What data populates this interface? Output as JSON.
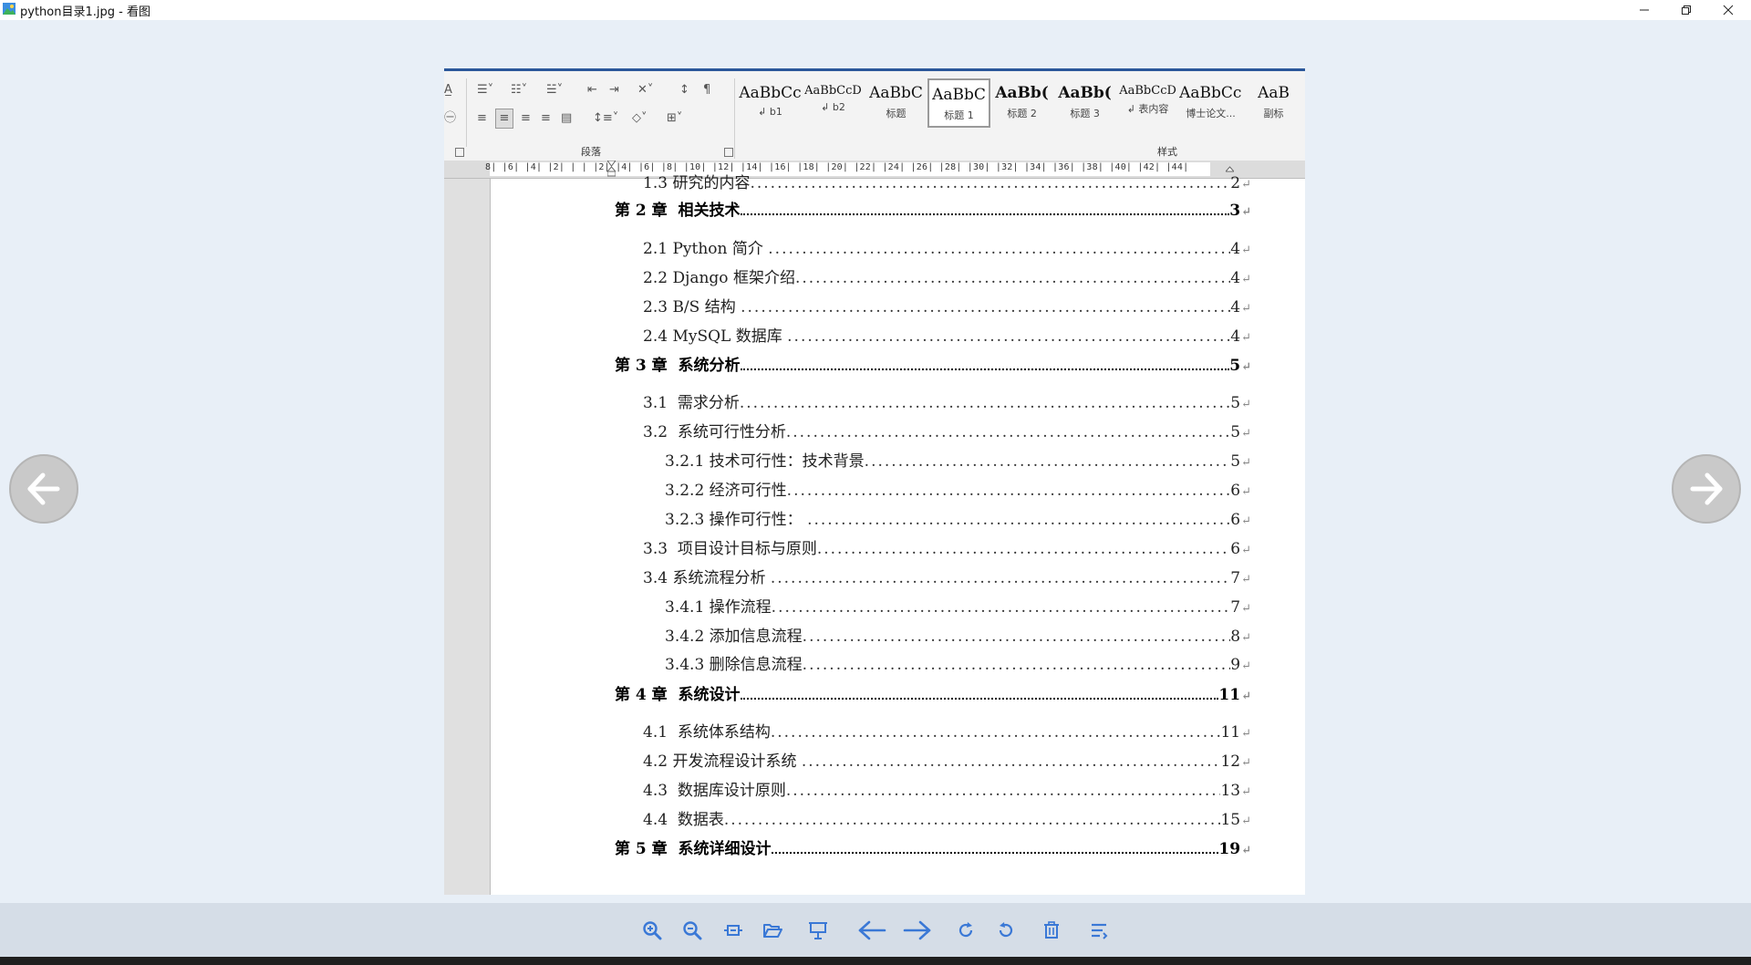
{
  "window": {
    "title": "python目录1.jpg - 看图",
    "minimize_label": "minimize",
    "restore_label": "restore",
    "close_label": "close"
  },
  "ribbon": {
    "paragraph_group_label": "段落",
    "styles_group_label": "样式",
    "styles": [
      {
        "sample": "AaBbCc",
        "name": "↲ b1"
      },
      {
        "sample": "AaBbCcD",
        "name": "↲ b2"
      },
      {
        "sample": "AaBbC",
        "name": "标题"
      },
      {
        "sample": "AaBbC",
        "name": "标题 1",
        "selected": true
      },
      {
        "sample": "AaBb(",
        "name": "标题 2"
      },
      {
        "sample": "AaBb(",
        "name": "标题 3"
      },
      {
        "sample": "AaBbCcD",
        "name": "↲ 表内容"
      },
      {
        "sample": "AaBbCcI",
        "name": "博士论文..."
      },
      {
        "sample": "AaB",
        "name": "副标"
      }
    ]
  },
  "ruler": {
    "ticks": "8| |6| |4| |2| | | |2| |4| |6| |8| |10| |12| |14| |16| |18| |20| |22| |24| |26| |28| |30| |32| |34| |36| |38| |40| |42| |44|"
  },
  "toc": [
    {
      "label": "1.3 研究的内容",
      "page": "2",
      "level": 2,
      "partial": true
    },
    {
      "label": "第 2 章  相关技术",
      "page": "3",
      "level": 1
    },
    {
      "label": "2.1 Python 简介 ",
      "page": "4",
      "level": 2
    },
    {
      "label": "2.2 Django 框架介绍",
      "page": "4",
      "level": 2
    },
    {
      "label": "2.3 B/S 结构 ",
      "page": "4",
      "level": 2
    },
    {
      "label": "2.4 MySQL 数据库 ",
      "page": "4",
      "level": 2
    },
    {
      "label": "第 3 章  系统分析",
      "page": "5",
      "level": 1
    },
    {
      "label": "3.1  需求分析",
      "page": "5",
      "level": 2
    },
    {
      "label": "3.2  系统可行性分析",
      "page": "5",
      "level": 2
    },
    {
      "label": "3.2.1 技术可行性：技术背景",
      "page": "5",
      "level": 3
    },
    {
      "label": "3.2.2 经济可行性",
      "page": "6",
      "level": 3
    },
    {
      "label": "3.2.3 操作可行性： ",
      "page": "6",
      "level": 3
    },
    {
      "label": "3.3  项目设计目标与原则",
      "page": "6",
      "level": 2
    },
    {
      "label": "3.4 系统流程分析 ",
      "page": "7",
      "level": 2
    },
    {
      "label": "3.4.1 操作流程",
      "page": "7",
      "level": 3
    },
    {
      "label": "3.4.2 添加信息流程",
      "page": "8",
      "level": 3
    },
    {
      "label": "3.4.3 删除信息流程",
      "page": "9",
      "level": 3
    },
    {
      "label": "第 4 章  系统设计",
      "page": "11",
      "level": 1
    },
    {
      "label": "4.1  系统体系结构",
      "page": "11",
      "level": 2
    },
    {
      "label": "4.2 开发流程设计系统 ",
      "page": "12",
      "level": 2
    },
    {
      "label": "4.3  数据库设计原则",
      "page": "13",
      "level": 2
    },
    {
      "label": "4.4  数据表",
      "page": "15",
      "level": 2
    },
    {
      "label": "第 5 章  系统详细设计",
      "page": "19",
      "level": 1
    }
  ],
  "navigation": {
    "prev_label": "previous image",
    "next_label": "next image"
  },
  "toolbar": {
    "buttons": [
      "zoom-in",
      "zoom-out",
      "fit-window",
      "open-folder",
      "slideshow",
      "previous",
      "next",
      "rotate-clockwise",
      "rotate-counterclockwise",
      "delete",
      "more"
    ]
  },
  "colors": {
    "accent": "#3a78d6",
    "background": "#e8eff7",
    "toolbar": "#d5dde7"
  }
}
